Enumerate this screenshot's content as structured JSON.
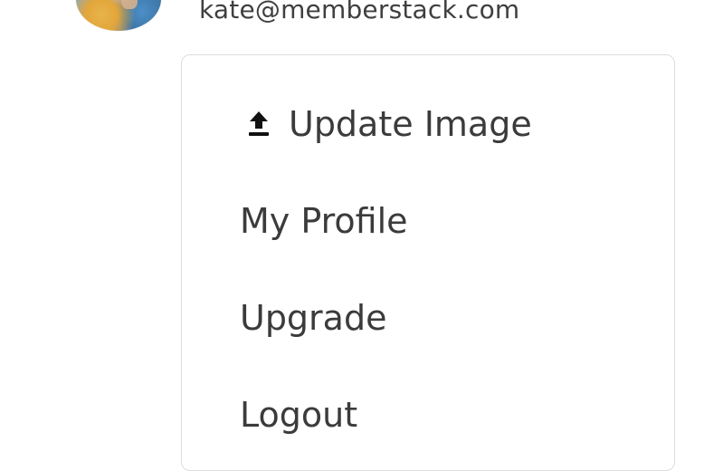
{
  "user": {
    "email": "kate@memberstack.com",
    "avatar_icon": "user-avatar"
  },
  "menu": {
    "items": [
      {
        "label": "Update Image",
        "icon": "upload-icon"
      },
      {
        "label": "My Profile"
      },
      {
        "label": "Upgrade"
      },
      {
        "label": "Logout"
      }
    ]
  }
}
